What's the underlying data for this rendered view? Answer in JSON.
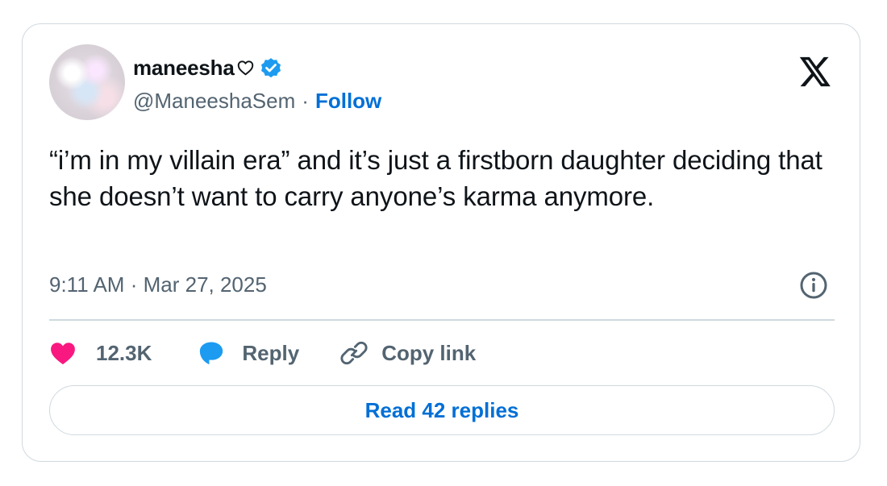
{
  "author": {
    "display_name": "maneesha",
    "handle": "@ManeeshaSem",
    "separator": "·",
    "follow_label": "Follow"
  },
  "tweet": {
    "text": "“i’m in my villain era” and it’s just a firstborn daughter deciding that she doesn’t want to carry anyone’s karma anymore.",
    "time": "9:11 AM",
    "date_sep": "·",
    "date": "Mar 27, 2025"
  },
  "actions": {
    "likes": "12.3K",
    "reply_label": "Reply",
    "copy_link_label": "Copy link"
  },
  "footer": {
    "read_replies_label": "Read 42 replies"
  },
  "icons": {
    "heart_outline": "heart-outline-icon",
    "verified": "verified-badge-icon",
    "x_logo": "x-logo-icon",
    "info": "info-icon",
    "like": "heart-icon",
    "reply": "speech-bubble-icon",
    "link": "link-icon"
  },
  "colors": {
    "like": "#f91880",
    "reply": "#1d9bf0",
    "verified": "#1d9bf0",
    "link": "#006fd6",
    "secondary_text": "#536471",
    "border": "#cfd9de"
  }
}
